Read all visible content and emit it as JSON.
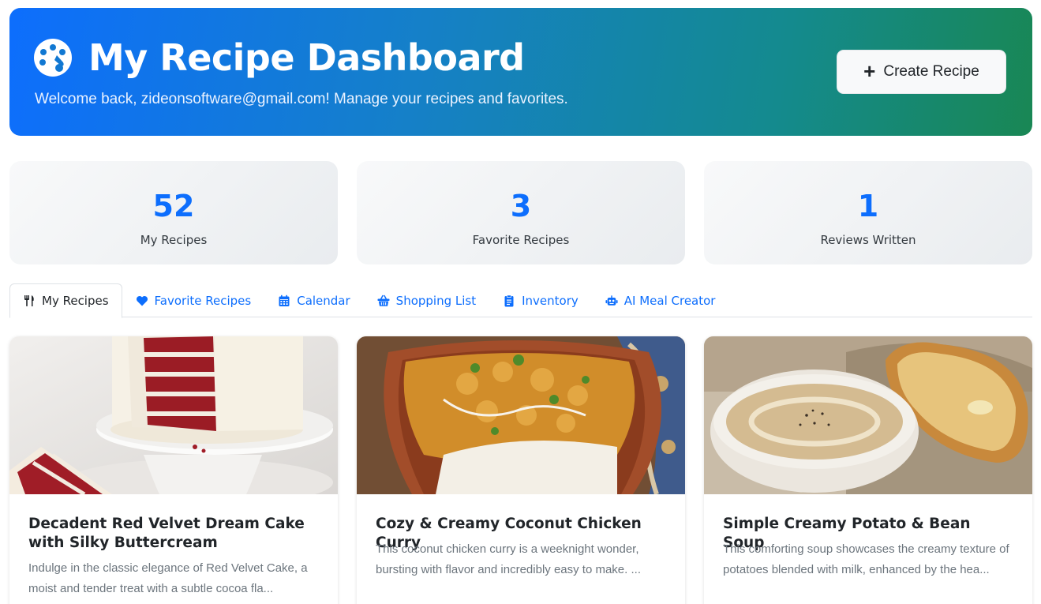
{
  "header": {
    "title": "My Recipe Dashboard",
    "subtitle": "Welcome back, zideonsoftware@gmail.com! Manage your recipes and favorites.",
    "icon": "palette-icon",
    "create_button": {
      "icon": "plus-icon",
      "label": "Create Recipe"
    }
  },
  "stats": [
    {
      "value": "52",
      "label": "My Recipes"
    },
    {
      "value": "3",
      "label": "Favorite Recipes"
    },
    {
      "value": "1",
      "label": "Reviews Written"
    }
  ],
  "tabs": [
    {
      "label": "My Recipes",
      "icon": "utensils-icon",
      "active": true
    },
    {
      "label": "Favorite Recipes",
      "icon": "heart-icon",
      "active": false
    },
    {
      "label": "Calendar",
      "icon": "calendar-icon",
      "active": false
    },
    {
      "label": "Shopping List",
      "icon": "basket-icon",
      "active": false
    },
    {
      "label": "Inventory",
      "icon": "clipboard-icon",
      "active": false
    },
    {
      "label": "AI Meal Creator",
      "icon": "robot-icon",
      "active": false
    }
  ],
  "recipes": [
    {
      "title": "Decadent Red Velvet Dream Cake with Silky Buttercream",
      "description": "Indulge in the classic elegance of Red Velvet Cake, a moist and tender treat with a subtle cocoa fla..."
    },
    {
      "title": "Cozy & Creamy Coconut Chicken Curry",
      "description": "This coconut chicken curry is a weeknight wonder, bursting with flavor and incredibly easy to make. ..."
    },
    {
      "title": "Simple Creamy Potato & Bean Soup",
      "description": "This comforting soup showcases the creamy texture of potatoes blended with milk, enhanced by the hea..."
    }
  ],
  "colors": {
    "primary": "#0d6efd",
    "success": "#198754",
    "muted_text": "#6c757d"
  }
}
